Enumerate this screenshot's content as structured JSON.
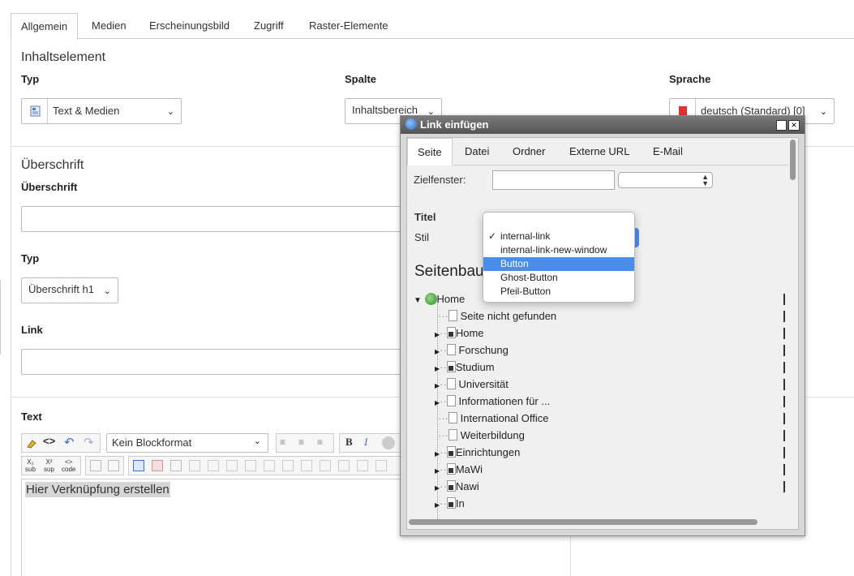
{
  "tabs": [
    "Allgemein",
    "Medien",
    "Erscheinungsbild",
    "Zugriff",
    "Raster-Elemente"
  ],
  "inhalt": {
    "title": "Inhaltselement",
    "typ_label": "Typ",
    "typ_value": "Text & Medien",
    "spalte_label": "Spalte",
    "spalte_value": "Inhaltsbereich",
    "sprache_label": "Sprache",
    "sprache_value": "deutsch (Standard) [0]"
  },
  "header": {
    "title": "Überschrift",
    "ueberschrift_label": "Überschrift",
    "ueberschrift_value": "",
    "typ_label": "Typ",
    "typ_value": "Überschrift h1",
    "link_label": "Link",
    "link_value": ""
  },
  "text": {
    "label": "Text",
    "blockformat": "Kein Blockformat",
    "content": "Hier Verknüpfung erstellen"
  },
  "dialog": {
    "title": "Link einfügen",
    "tabs": [
      "Seite",
      "Datei",
      "Ordner",
      "Externe URL",
      "E-Mail"
    ],
    "zielfenster_label": "Zielfenster:",
    "titel_label": "Titel",
    "stil_label": "Stil",
    "tree_title": "Seitenbau",
    "tree_root": "Home",
    "tree_items": [
      "Seite nicht gefunden",
      "Home",
      "Forschung",
      "Studium",
      "Universität",
      "Informationen für ...",
      "International Office",
      "Weiterbildung",
      "Einrichtungen",
      "MaWi",
      "Nawi",
      "In"
    ]
  },
  "stil_menu": {
    "options": [
      "internal-link",
      "internal-link-new-window",
      "Button",
      "Ghost-Button",
      "Pfeil-Button"
    ],
    "checked_index": 0,
    "highlighted_index": 2
  }
}
